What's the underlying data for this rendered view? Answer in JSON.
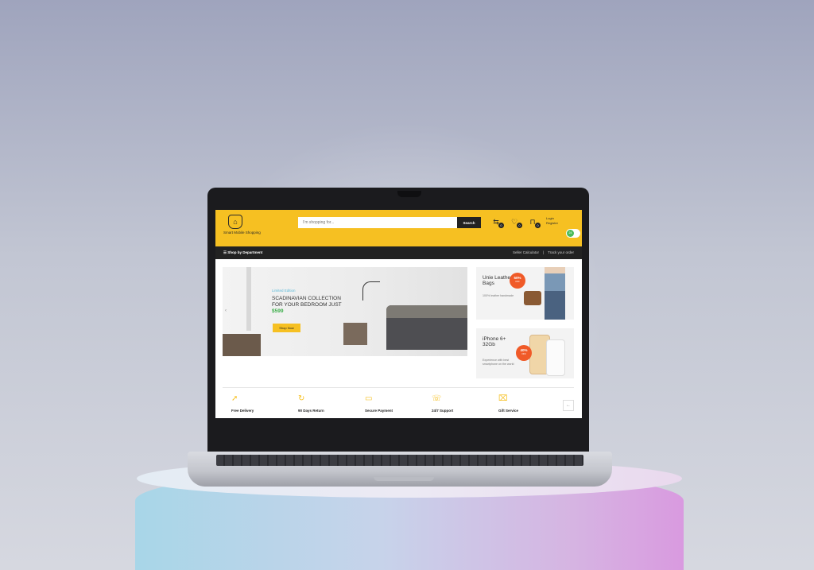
{
  "header": {
    "logo_text": "Smart Mobile Shopping",
    "search_placeholder": "I'm shopping for...",
    "search_button": "Search",
    "cart_count": "0",
    "compare_count": "0",
    "wishlist_count": "0",
    "login_label": "Login",
    "register_label": "Register",
    "chat_badge": "24"
  },
  "nav": {
    "shop_by_department": "Shop by Department",
    "seller_calculator": "Seller Calculator",
    "track_order": "Track your order"
  },
  "banner": {
    "tag": "Limited Edition",
    "title": "Scadinavian collection for your bedroom just",
    "price": "$599",
    "button": "Shop Now"
  },
  "promo_cards": [
    {
      "title": "Unie Leather Bags",
      "sub": "100% leather handmade",
      "badge_pct": "50%",
      "badge_word": "OFF"
    },
    {
      "title": "iPhone 6+ 32Gb",
      "sub": "Experience with best smartphone on the world",
      "badge_pct": "40%",
      "badge_word": "OFF"
    }
  ],
  "features": [
    {
      "label": "Free Delivery",
      "icon": "rocket-icon"
    },
    {
      "label": "90 Days Return",
      "icon": "return-icon"
    },
    {
      "label": "Secure Payment",
      "icon": "card-icon"
    },
    {
      "label": "24/7 Support",
      "icon": "support-icon"
    },
    {
      "label": "Gift Service",
      "icon": "gift-icon"
    }
  ],
  "colors": {
    "brand_yellow": "#f6c022",
    "nav_dark": "#222222",
    "badge_orange": "#f05a28",
    "price_green": "#3cae4a",
    "chat_green": "#4cbb5a"
  }
}
